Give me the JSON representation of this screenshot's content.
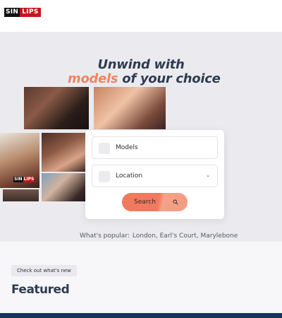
{
  "header": {
    "logo_part1": "SIN",
    "logo_part2": "LIPS"
  },
  "hero": {
    "headline_line1": "Unwind with",
    "headline_accent": "models",
    "headline_rest": " of your choice",
    "photo_logo_part1": "SIN",
    "photo_logo_part2": "LIPS"
  },
  "search": {
    "models_label": "Models",
    "location_label": "Location",
    "button_label": "Search"
  },
  "popular": {
    "label": "What's popular:",
    "links": "London, Earl's Court, Marylebone"
  },
  "featured": {
    "chip": "Check out what's new",
    "title": "Featured"
  },
  "colors": {
    "accent": "#ef8462",
    "navy": "#2e3c52",
    "brand_red": "#c4161c",
    "footer_bar": "#17345a"
  },
  "icons": [
    "search-icon",
    "chevron-down-icon"
  ]
}
